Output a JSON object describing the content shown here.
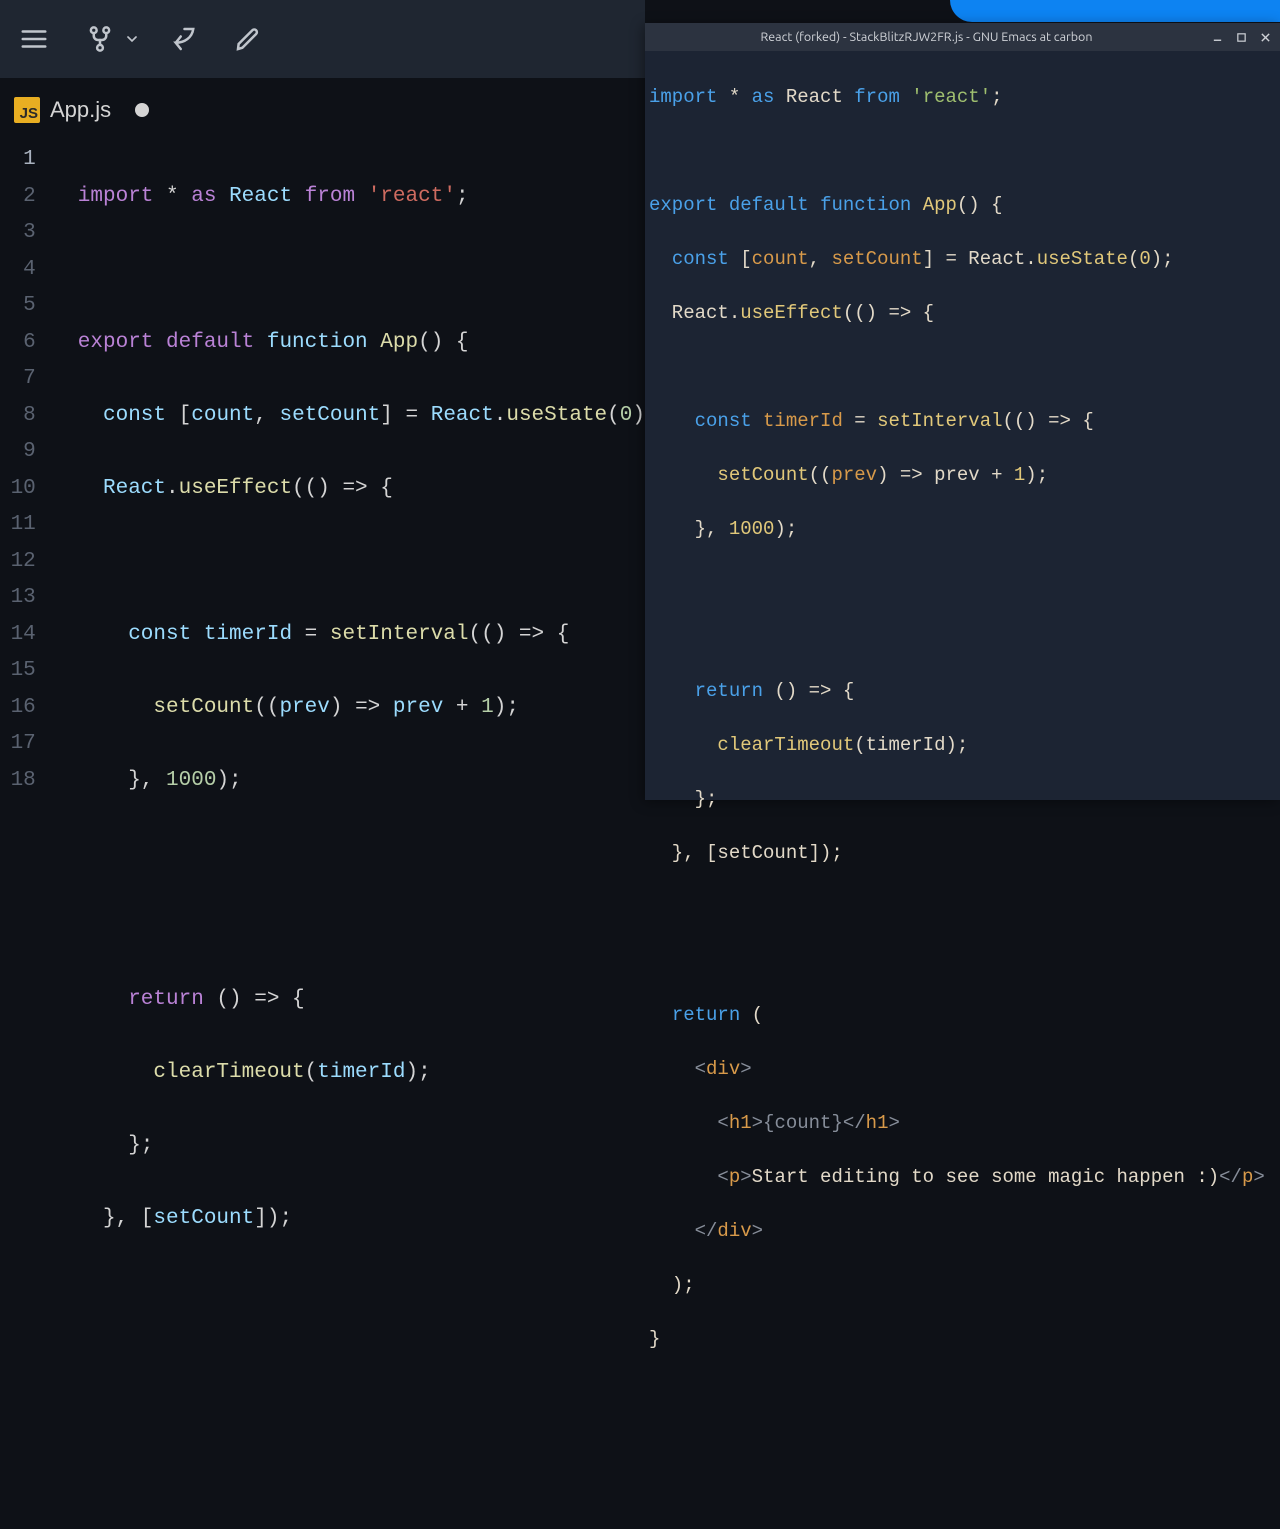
{
  "toolbar": {
    "menu_icon": "hamburger-icon",
    "fork_icon": "fork-icon",
    "fork_chevron": "chevron-down-icon",
    "share_icon": "share-icon",
    "edit_icon": "pencil-icon"
  },
  "tab": {
    "badge_text": "JS",
    "filename": "App.js"
  },
  "line_numbers": [
    "1",
    "2",
    "3",
    "4",
    "5",
    "6",
    "7",
    "8",
    "9",
    "10",
    "11",
    "12",
    "13",
    "14",
    "15",
    "16",
    "17",
    "18"
  ],
  "code_left": {
    "l1": {
      "import": "import",
      "star": "*",
      "as": "as",
      "react_id": "React",
      "from": "from",
      "react_str": "'react'",
      "semi": ";"
    },
    "l3": {
      "export": "export",
      "default": "default",
      "function": "function",
      "app": "App",
      "paren": "() {"
    },
    "l4": {
      "const": "const",
      "arr": "[",
      "count": "count",
      "comma": ", ",
      "setcount": "setCount",
      "close": "] = ",
      "react": "React",
      "dot": ".",
      "usestate": "useState",
      "arg": "(",
      "zero": "0",
      "end": ")"
    },
    "l5": {
      "react": "React",
      "dot": ".",
      "useeffect": "useEffect",
      "rest": "(() => {"
    },
    "l7": {
      "const": "const",
      "timerid": "timerId",
      "eq": " = ",
      "setinterval": "setInterval",
      "rest": "(() => {"
    },
    "l8": {
      "setcount": "setCount",
      "open": "((",
      "prev": "prev",
      "mid": ") => ",
      "prev2": "prev",
      "plus": " + ",
      "one": "1",
      "end": ");"
    },
    "l9": {
      "close": "}, ",
      "thousand": "1000",
      "end": ");"
    },
    "l12": {
      "return": "return",
      "rest": " () => {"
    },
    "l13": {
      "cleartimeout": "clearTimeout",
      "open": "(",
      "timerid": "timerId",
      "end": ");"
    },
    "l14": {
      "close": "};"
    },
    "l15": {
      "open": "}, [",
      "setcount": "setCount",
      "end": "]);"
    }
  },
  "emacs": {
    "window_title": "React (forked) - StackBlitzRJW2FR.js - GNU Emacs at carbon",
    "min_icon": "minimize-icon",
    "max_icon": "maximize-icon",
    "close_icon": "close-icon"
  },
  "code_right": {
    "l1": {
      "import": "import",
      "star": " * ",
      "as": "as",
      "react_id": " React ",
      "from": "from",
      "react_str": " 'react'",
      "semi": ";"
    },
    "l3": {
      "export": "export",
      "default": "default",
      "function": "function",
      "app": "App",
      "paren": "() {"
    },
    "l4": {
      "const": "const",
      "open": " [",
      "count": "count",
      "comma": ", ",
      "setcount": "setCount",
      "close": "] = React.",
      "usestate": "useState",
      "p": "(",
      "zero": "0",
      "end": ");"
    },
    "l5": {
      "react": "  React.",
      "useeffect": "useEffect",
      "rest": "(() => {"
    },
    "l7": {
      "const": "const",
      "sp": " ",
      "timerid": "timerId",
      "eq": " = ",
      "setinterval": "setInterval",
      "rest": "(() => {"
    },
    "l8": {
      "indent": "      ",
      "setcount": "setCount",
      "open": "((",
      "prev": "prev",
      "mid": ") => prev + ",
      "one": "1",
      "end": ");"
    },
    "l9": {
      "close": "    }, ",
      "thousand": "1000",
      "end": ");"
    },
    "l12": {
      "return": "return",
      "rest": " () => {"
    },
    "l13": {
      "indent": "      ",
      "cleartimeout": "clearTimeout",
      "open": "(timerId);"
    },
    "l14": {
      "close": "    };"
    },
    "l15": {
      "open": "  }, [setCount]);"
    },
    "l18": {
      "return": "return",
      "rest": " ("
    },
    "l19": {
      "open": "    <",
      "div": "div",
      "close": ">"
    },
    "l20": {
      "open": "      <",
      "h1": "h1",
      "mid": ">{count}</",
      "h1b": "h1",
      "end": ">"
    },
    "l21": {
      "open": "      <",
      "p": "p",
      "mid": ">",
      "text": "Start editing to see some magic happen :)",
      "close": "</",
      "p2": "p",
      "end": ">"
    },
    "l22": {
      "open": "    </",
      "div": "div",
      "end": ">"
    },
    "l23": {
      "close": "  );"
    },
    "l24": {
      "close": "}"
    }
  }
}
